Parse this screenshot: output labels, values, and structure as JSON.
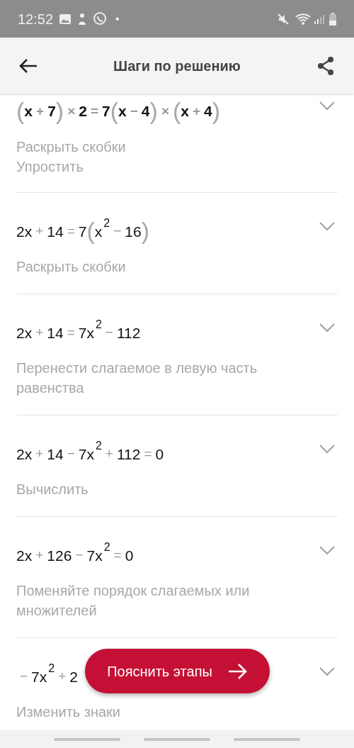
{
  "status_bar": {
    "time": "12:52",
    "dot": "•"
  },
  "header": {
    "title": "Шаги по решению"
  },
  "steps": [
    {
      "bold": true,
      "expanded": false,
      "tokens": [
        {
          "kind": "paren",
          "text": "("
        },
        {
          "kind": "term",
          "text": "x"
        },
        {
          "kind": "op",
          "text": "+"
        },
        {
          "kind": "term",
          "text": "7"
        },
        {
          "kind": "paren",
          "text": ")"
        },
        {
          "kind": "op",
          "text": "×"
        },
        {
          "kind": "term",
          "text": "2"
        },
        {
          "kind": "op",
          "text": "="
        },
        {
          "kind": "term",
          "text": "7"
        },
        {
          "kind": "paren",
          "text": "("
        },
        {
          "kind": "term",
          "text": "x"
        },
        {
          "kind": "op",
          "text": "−"
        },
        {
          "kind": "term",
          "text": "4"
        },
        {
          "kind": "paren",
          "text": ")"
        },
        {
          "kind": "op",
          "text": "×"
        },
        {
          "kind": "paren",
          "text": "("
        },
        {
          "kind": "term",
          "text": "x"
        },
        {
          "kind": "op",
          "text": "+"
        },
        {
          "kind": "term",
          "text": "4"
        },
        {
          "kind": "paren",
          "text": ")"
        }
      ],
      "description": [
        "Раскрыть скобки",
        "Упростить"
      ]
    },
    {
      "bold": false,
      "expanded": false,
      "tokens": [
        {
          "kind": "term",
          "text": "2x"
        },
        {
          "kind": "op",
          "text": "+"
        },
        {
          "kind": "term",
          "text": "14"
        },
        {
          "kind": "op",
          "text": "="
        },
        {
          "kind": "term",
          "text": "7"
        },
        {
          "kind": "paren",
          "text": "("
        },
        {
          "kind": "term",
          "text": "x"
        },
        {
          "kind": "power",
          "text": "2"
        },
        {
          "kind": "op",
          "text": "−"
        },
        {
          "kind": "term",
          "text": "16"
        },
        {
          "kind": "paren",
          "text": ")"
        }
      ],
      "description": [
        "Раскрыть скобки"
      ]
    },
    {
      "bold": false,
      "expanded": false,
      "tokens": [
        {
          "kind": "term",
          "text": "2x"
        },
        {
          "kind": "op",
          "text": "+"
        },
        {
          "kind": "term",
          "text": "14"
        },
        {
          "kind": "op",
          "text": "="
        },
        {
          "kind": "term",
          "text": "7x"
        },
        {
          "kind": "power",
          "text": "2"
        },
        {
          "kind": "op",
          "text": "−"
        },
        {
          "kind": "term",
          "text": "112"
        }
      ],
      "description": [
        "Перенести слагаемое в левую часть равенства"
      ]
    },
    {
      "bold": false,
      "expanded": false,
      "tokens": [
        {
          "kind": "term",
          "text": "2x"
        },
        {
          "kind": "op",
          "text": "+"
        },
        {
          "kind": "term",
          "text": "14"
        },
        {
          "kind": "op",
          "text": "−"
        },
        {
          "kind": "term",
          "text": "7x"
        },
        {
          "kind": "power",
          "text": "2"
        },
        {
          "kind": "op",
          "text": "+"
        },
        {
          "kind": "term",
          "text": "112"
        },
        {
          "kind": "op",
          "text": "="
        },
        {
          "kind": "term",
          "text": "0"
        }
      ],
      "description": [
        "Вычислить"
      ]
    },
    {
      "bold": false,
      "expanded": false,
      "tokens": [
        {
          "kind": "term",
          "text": "2x"
        },
        {
          "kind": "op",
          "text": "+"
        },
        {
          "kind": "term",
          "text": "126"
        },
        {
          "kind": "op",
          "text": "−"
        },
        {
          "kind": "term",
          "text": "7x"
        },
        {
          "kind": "power",
          "text": "2"
        },
        {
          "kind": "op",
          "text": "="
        },
        {
          "kind": "term",
          "text": "0"
        }
      ],
      "description": [
        "Поменяйте порядок слагаемых или множителей"
      ]
    },
    {
      "bold": false,
      "expanded": false,
      "tokens": [
        {
          "kind": "op",
          "text": "−"
        },
        {
          "kind": "term",
          "text": "7x"
        },
        {
          "kind": "power",
          "text": "2"
        },
        {
          "kind": "op",
          "text": "+"
        },
        {
          "kind": "term",
          "text": "2"
        }
      ],
      "description": [
        "Изменить знаки"
      ]
    }
  ],
  "fab": {
    "label": "Пояснить этапы"
  }
}
